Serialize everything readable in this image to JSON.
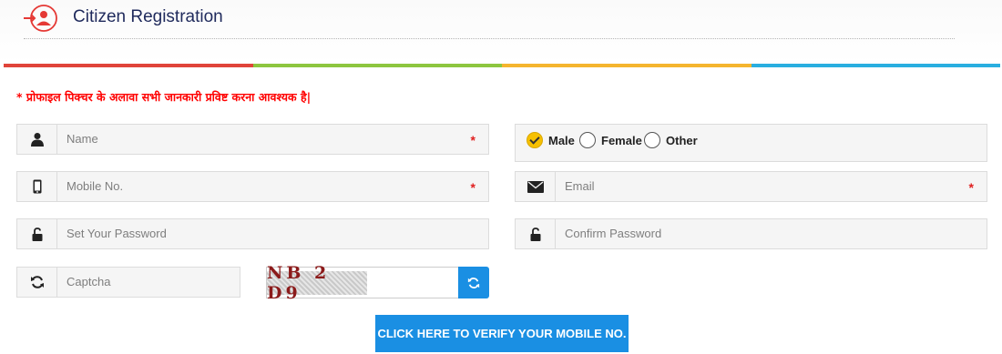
{
  "header": {
    "title": "Citizen Registration",
    "icon": "user-add-icon",
    "accent_color": "#e53935"
  },
  "color_bar": [
    "#e0443a",
    "#8dc63f",
    "#f5b52e",
    "#29aee0"
  ],
  "notice": "* प्रोफाइल पिक्चर के अलावा सभी जानकारी प्रविष्ट करना आवश्यक है|",
  "form": {
    "name": {
      "placeholder": "Name",
      "icon": "user-icon",
      "required": "*"
    },
    "mobile": {
      "placeholder": "Mobile No.",
      "icon": "mobile-icon",
      "required": "*"
    },
    "email": {
      "placeholder": "Email",
      "icon": "envelope-icon",
      "required": "*"
    },
    "password": {
      "placeholder": "Set Your Password",
      "icon": "unlock-icon"
    },
    "confirm_password": {
      "placeholder": "Confirm Password",
      "icon": "unlock-icon"
    },
    "captcha": {
      "placeholder": "Captcha",
      "icon": "refresh-icon",
      "image_text": "NB 2 D9"
    },
    "gender": {
      "options": [
        "Male",
        "Female",
        "Other"
      ],
      "selected": "Male"
    }
  },
  "verify_button": "CLICK HERE TO VERIFY YOUR MOBILE NO.",
  "button_color": "#1a8fe3"
}
